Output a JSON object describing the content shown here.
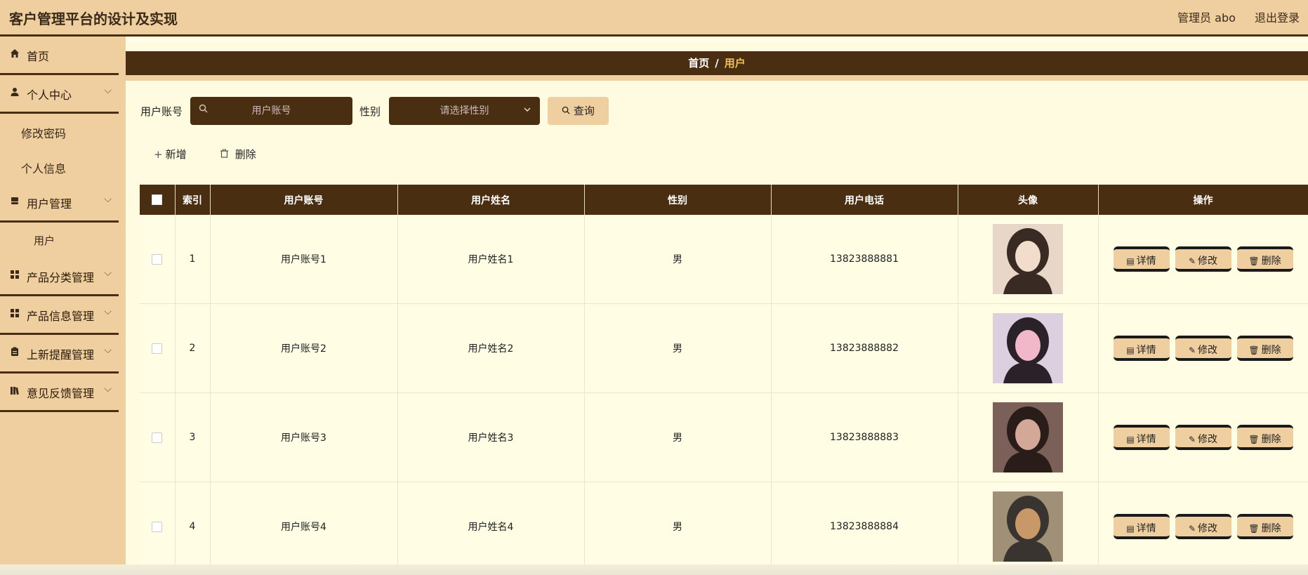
{
  "header": {
    "title": "客户管理平台的设计及实现",
    "user_label": "管理员 abo",
    "logout_label": "退出登录"
  },
  "sidebar": {
    "items": [
      {
        "label": "首页",
        "icon": "home-icon"
      },
      {
        "label": "个人中心",
        "icon": "person-icon"
      },
      {
        "label": "修改密码"
      },
      {
        "label": "个人信息"
      },
      {
        "label": "用户管理",
        "icon": "database-icon"
      },
      {
        "label": "用户"
      },
      {
        "label": "产品分类管理",
        "icon": "grid-icon"
      },
      {
        "label": "产品信息管理",
        "icon": "grid-icon"
      },
      {
        "label": "上新提醒管理",
        "icon": "clipboard-icon"
      },
      {
        "label": "意见反馈管理",
        "icon": "book-icon"
      }
    ]
  },
  "breadcrumb": {
    "home": "首页",
    "separator": "/",
    "current": "用户"
  },
  "search": {
    "account_label": "用户账号",
    "account_placeholder": "用户账号",
    "sex_label": "性别",
    "sex_placeholder": "请选择性别",
    "query_label": "查询"
  },
  "actions": {
    "add_label": "新增",
    "delete_label": "删除"
  },
  "table": {
    "headers": [
      "索引",
      "用户账号",
      "用户姓名",
      "性别",
      "用户电话",
      "头像",
      "操作"
    ],
    "rows": [
      {
        "index": "1",
        "account": "用户账号1",
        "name": "用户姓名1",
        "sex": "男",
        "phone": "13823888881"
      },
      {
        "index": "2",
        "account": "用户账号2",
        "name": "用户姓名2",
        "sex": "男",
        "phone": "13823888882"
      },
      {
        "index": "3",
        "account": "用户账号3",
        "name": "用户姓名3",
        "sex": "男",
        "phone": "13823888883"
      },
      {
        "index": "4",
        "account": "用户账号4",
        "name": "用户姓名4",
        "sex": "男",
        "phone": "13823888884"
      }
    ],
    "op_labels": {
      "detail": "详情",
      "edit": "修改",
      "delete": "删除"
    }
  },
  "colors": {
    "header_bg": "#efcfa0",
    "dark_brown": "#4a2e12",
    "content_bg": "#fffbe0",
    "accent_text": "#f0c060"
  }
}
